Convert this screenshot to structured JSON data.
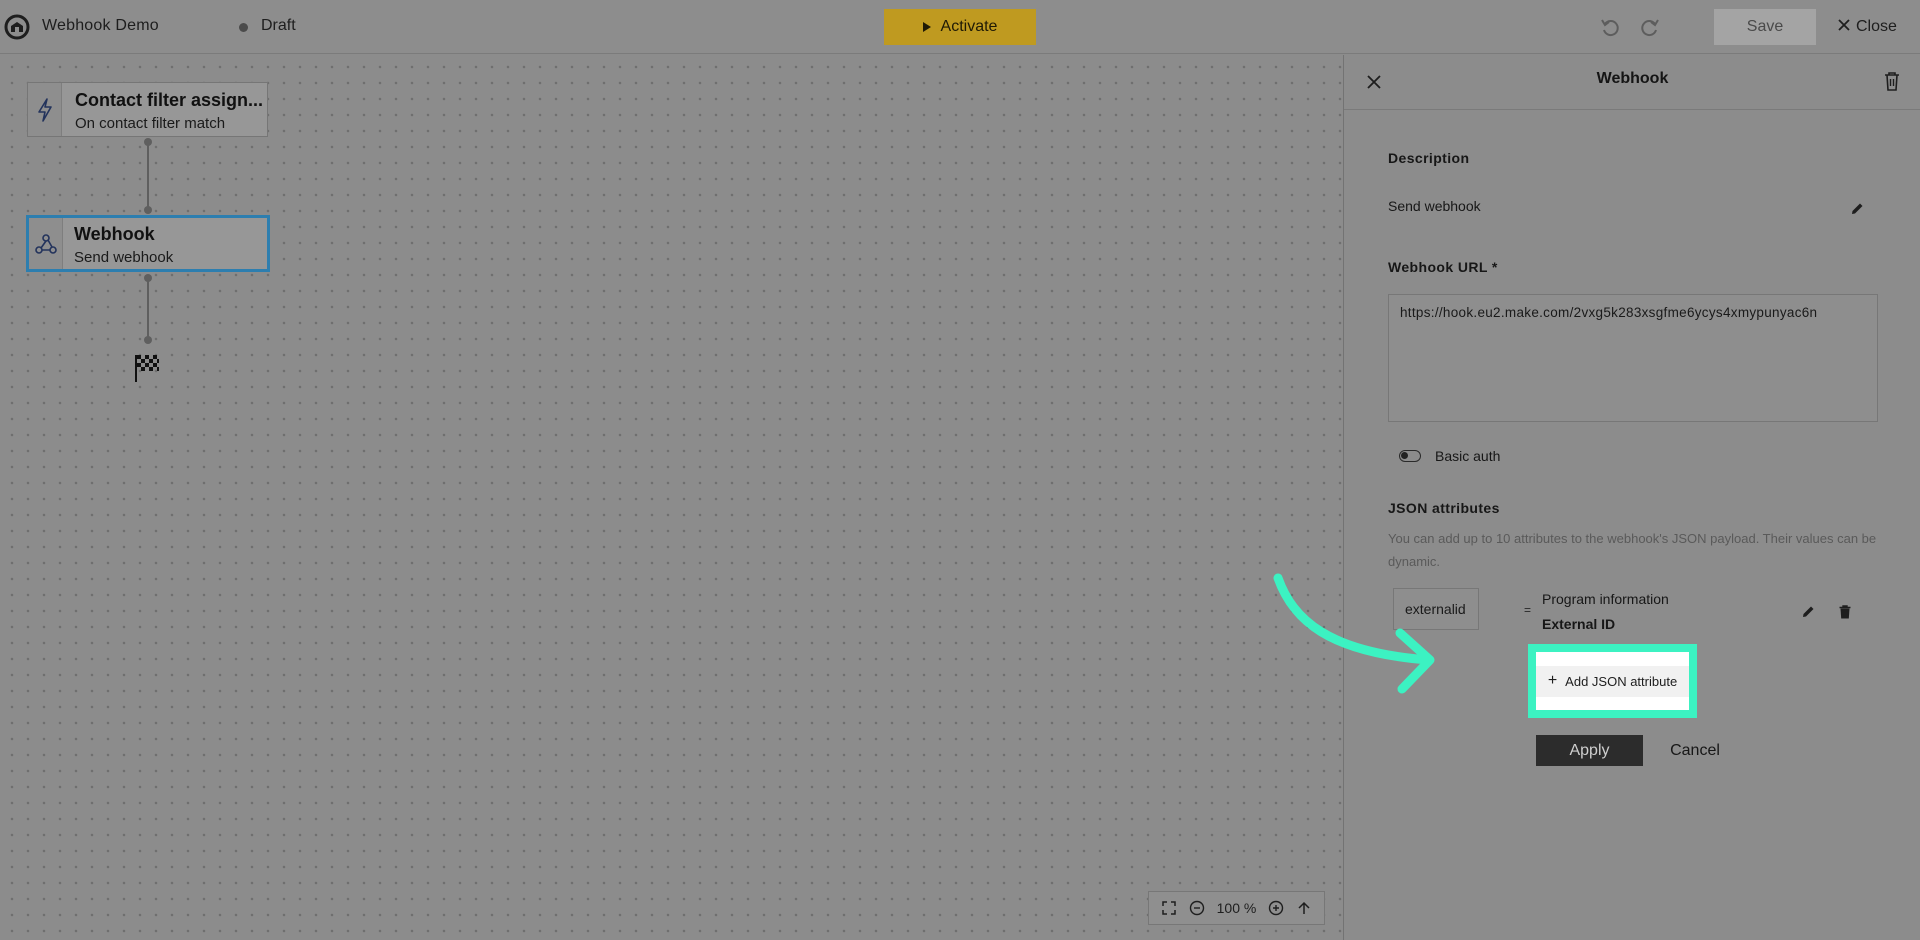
{
  "header": {
    "app_title": "Webhook Demo",
    "status": "Draft",
    "activate_label": "Activate",
    "save_label": "Save",
    "close_label": "Close",
    "icons": [
      "app-logo-icon",
      "undo-icon",
      "redo-icon",
      "play-icon",
      "close-icon"
    ]
  },
  "workflow": {
    "nodes": [
      {
        "title": "Contact filter assign...",
        "subtitle": "On contact filter match",
        "icon": "lightning-icon"
      },
      {
        "title": "Webhook",
        "subtitle": "Send webhook",
        "icon": "webhook-icon",
        "selected": true
      }
    ],
    "end_icon": "checkered-flag-icon",
    "zoom_label": "100 %",
    "colors": {
      "selected_border": "#2d7eaf"
    }
  },
  "panel": {
    "title": "Webhook",
    "description_label": "Description",
    "description_value": "Send webhook",
    "url_label": "Webhook URL *",
    "url_value": "https://hook.eu2.make.com/2vxg5k283xsgfme6ycys4xmypunyac6n",
    "basic_auth_label": "Basic auth",
    "basic_auth_enabled": false,
    "json_label": "JSON attributes",
    "json_help": "You can add up to 10 attributes to the webhook's JSON payload. Their values can be dynamic.",
    "attributes": [
      {
        "key": "externalid",
        "source": "Program information",
        "field": "External ID"
      }
    ],
    "add_attr_label": "Add JSON attribute",
    "apply_label": "Apply",
    "cancel_label": "Cancel",
    "colors": {
      "highlight": "#3cf2c2",
      "activate": "#bf9a20"
    }
  }
}
